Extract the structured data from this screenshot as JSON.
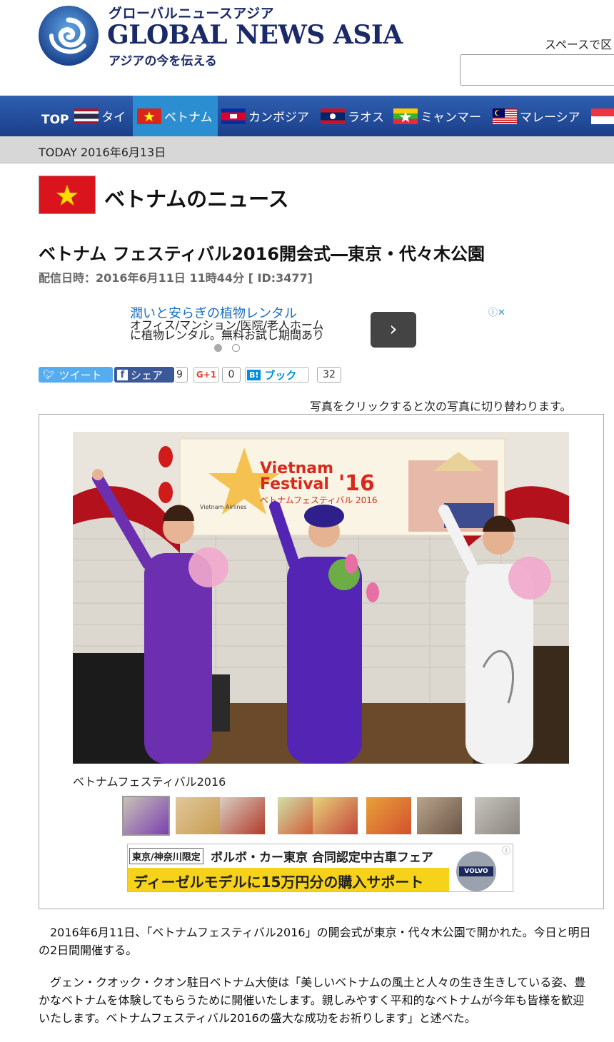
{
  "header": {
    "logo_jp": "グローバルニュースアジア",
    "logo_en": "GLOBAL NEWS ASIA",
    "tagline": "アジアの今を伝える",
    "search_label": "スペースで区",
    "search_value": ""
  },
  "nav": {
    "top": "TOP",
    "items": [
      {
        "label": "タイ",
        "flag": "thailand-flag-icon"
      },
      {
        "label": "ベトナム",
        "flag": "vietnam-flag-icon"
      },
      {
        "label": "カンボジア",
        "flag": "cambodia-flag-icon"
      },
      {
        "label": "ラオス",
        "flag": "laos-flag-icon"
      },
      {
        "label": "ミャンマー",
        "flag": "myanmar-flag-icon"
      },
      {
        "label": "マレーシア",
        "flag": "malaysia-flag-icon"
      }
    ]
  },
  "today": "TODAY 2016年6月13日",
  "section_title": "ベトナムのニュース",
  "article": {
    "title": "ベトナム フェスティバル2016開会式―東京・代々木公園",
    "meta": "配信日時：2016年6月11日 11時44分 [ ID:3477]",
    "photo_caption": "ベトナムフェスティバル2016",
    "click_note": "写真をクリックすると次の写真に切り替わります。",
    "paragraphs": [
      "2016年6月11日、「ベトナムフェスティバル2016」の開会式が東京・代々木公園で開かれた。今日と明日の2日間開催する。",
      "グェン・クオック・クオン駐日ベトナム大使は「美しいベトナムの風土と人々の生き生きしている姿、豊かなベトナムを体験してもらうために開催いたします。親しみやすく平和的なベトナムが今年も皆様を歓迎いたします。ベトナムフェスティバル2016の盛大な成功をお祈りします」と述べた。"
    ]
  },
  "ad1": {
    "title": "潤いと安らぎの植物レンタル",
    "desc": "オフィス/マンション/医院/老人ホーム に植物レンタル。無料お試し期間あり",
    "button": "›",
    "info": "ⓘ✕"
  },
  "share": {
    "tweet": "ツイート",
    "fb": "シェア",
    "fb_count": "9",
    "gplus": "G+1",
    "gplus_count": "0",
    "hatena": "B!",
    "hatena_label": "ブック",
    "hatena_count": "32"
  },
  "photo": {
    "banner_en1": "Vietnam",
    "banner_en2": "Festival",
    "banner_year": "'16",
    "banner_jp": "ベトナムフェスティバル 2016",
    "sponsor": "Vietnam Airlines"
  },
  "ad2": {
    "tag": "東京/神奈川限定",
    "line1": "ボルボ・カー東京 合同認定中古車フェア",
    "line2": "ディーゼルモデルに15万円分の購入サポート",
    "brand": "VOLVO",
    "info": "ⓘ"
  },
  "colors": {
    "nav_bg": "#1a3f8a",
    "nav_active": "#2b8ed0",
    "brand_blue": "#1b2a66",
    "vietnam_red": "#d9141c"
  }
}
